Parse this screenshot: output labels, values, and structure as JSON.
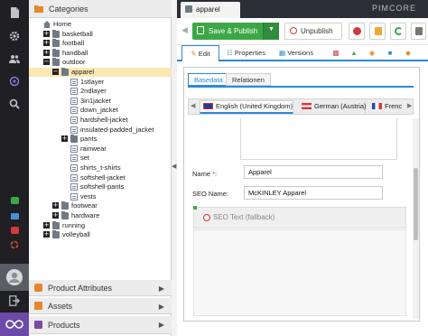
{
  "tree_panel": {
    "title": "Categories"
  },
  "tree": [
    {
      "label": "Home",
      "depth": 0,
      "toggle": "",
      "icon": "home"
    },
    {
      "label": "basketball",
      "depth": 1,
      "toggle": "+",
      "icon": "folder"
    },
    {
      "label": "football",
      "depth": 1,
      "toggle": "+",
      "icon": "folder"
    },
    {
      "label": "handball",
      "depth": 1,
      "toggle": "+",
      "icon": "folder"
    },
    {
      "label": "outdoor",
      "depth": 1,
      "toggle": "-",
      "icon": "folder"
    },
    {
      "label": "apparel",
      "depth": 2,
      "toggle": "-",
      "icon": "folder",
      "selected": true
    },
    {
      "label": "1stlayer",
      "depth": 3,
      "toggle": "",
      "icon": "doc"
    },
    {
      "label": "2ndlayer",
      "depth": 3,
      "toggle": "",
      "icon": "doc"
    },
    {
      "label": "3in1jacket",
      "depth": 3,
      "toggle": "",
      "icon": "doc"
    },
    {
      "label": "down_jacket",
      "depth": 3,
      "toggle": "",
      "icon": "doc"
    },
    {
      "label": "hardshell-jacket",
      "depth": 3,
      "toggle": "",
      "icon": "doc"
    },
    {
      "label": "insulated-padded_jacket",
      "depth": 3,
      "toggle": "",
      "icon": "doc"
    },
    {
      "label": "pants",
      "depth": 3,
      "toggle": "+",
      "icon": "folder"
    },
    {
      "label": "rainwear",
      "depth": 3,
      "toggle": "",
      "icon": "doc"
    },
    {
      "label": "set",
      "depth": 3,
      "toggle": "",
      "icon": "doc"
    },
    {
      "label": "shirts_t-shirts",
      "depth": 3,
      "toggle": "",
      "icon": "doc"
    },
    {
      "label": "softshell-jacket",
      "depth": 3,
      "toggle": "",
      "icon": "doc"
    },
    {
      "label": "softshell-pants",
      "depth": 3,
      "toggle": "",
      "icon": "doc"
    },
    {
      "label": "vests",
      "depth": 3,
      "toggle": "",
      "icon": "doc"
    },
    {
      "label": "footwear",
      "depth": 2,
      "toggle": "+",
      "icon": "folder"
    },
    {
      "label": "hardware",
      "depth": 2,
      "toggle": "+",
      "icon": "folder"
    },
    {
      "label": "running",
      "depth": 1,
      "toggle": "+",
      "icon": "folder"
    },
    {
      "label": "volleyball",
      "depth": 1,
      "toggle": "+",
      "icon": "folder"
    }
  ],
  "accordion": {
    "product_attributes": "Product Attributes",
    "assets": "Assets",
    "products": "Products"
  },
  "document_tab": {
    "title": "apparel"
  },
  "brand": "PIMCORE",
  "toolbar": {
    "save_publish": "Save & Publish",
    "unpublish": "Unpublish"
  },
  "object_tabs": {
    "edit": "Edit",
    "properties": "Properties",
    "versions": "Versions"
  },
  "layout_tabs": {
    "basedata": "Basedata",
    "relationen": "Relationen"
  },
  "language_tabs": {
    "english": "English (United Kingdom)",
    "german": "German (Austria)",
    "french": "Frenc"
  },
  "form": {
    "name_label": "Name",
    "name_required": "*",
    "name_value": "Apparel",
    "seo_name_label": "SEO Name:",
    "seo_name_value": "McKINLEY Apparel",
    "seo_text_label": "SEO Text (fallback)"
  },
  "colors": {
    "sidebar_bg": "#1f1f24",
    "accent_green": "#3da748",
    "tab_blue": "#2b8ad6",
    "selected_row": "#fbe8b3",
    "accordion_orange": "#e8862a",
    "accordion_purple": "#7a4aa3"
  }
}
